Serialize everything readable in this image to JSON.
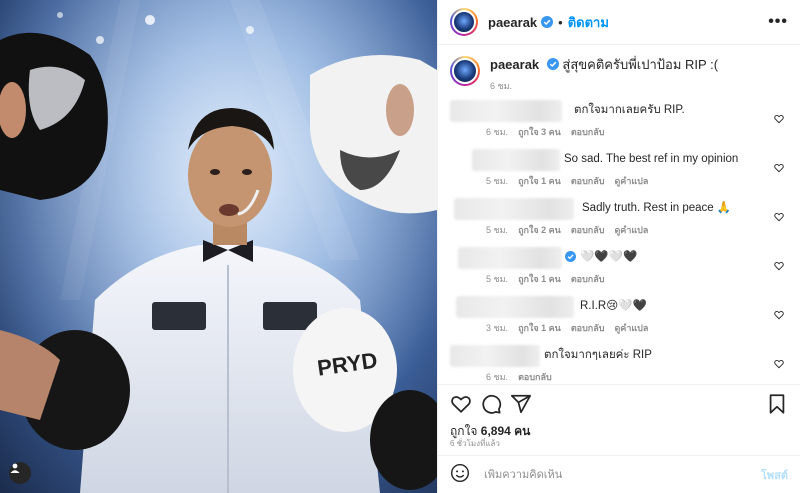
{
  "header": {
    "username": "paearak",
    "follow_label": "ติดตาม",
    "more_label": "•••"
  },
  "caption": {
    "username": "paearak",
    "text": "สู่สุขคติครับพี่เปาป้อม RIP :(",
    "time": "6 ชม."
  },
  "comments": [
    {
      "text": "ตกใจมากเลยครับ RIP.",
      "time": "6 ชม.",
      "likes": "ถูกใจ 3 คน",
      "reply": "ตอบกลับ",
      "translate": ""
    },
    {
      "text": "So sad. The best ref in my opinion",
      "time": "5 ชม.",
      "likes": "ถูกใจ 1 คน",
      "reply": "ตอบกลับ",
      "translate": "ดูคำแปล"
    },
    {
      "text": "Sadly truth. Rest in peace 🙏",
      "time": "5 ชม.",
      "likes": "ถูกใจ 2 คน",
      "reply": "ตอบกลับ",
      "translate": "ดูคำแปล"
    },
    {
      "text": "🤍🖤🤍🖤",
      "time": "5 ชม.",
      "likes": "ถูกใจ 1 คน",
      "reply": "ตอบกลับ",
      "translate": ""
    },
    {
      "text": "R.I.R😢🤍🖤",
      "time": "3 ชม.",
      "likes": "ถูกใจ 1 คน",
      "reply": "ตอบกลับ",
      "translate": "ดูคำแปล"
    },
    {
      "text": "ตกใจมากๆเลยค่ะ RIP",
      "time": "6 ชม.",
      "likes": "",
      "reply": "ตอบกลับ",
      "translate": ""
    }
  ],
  "likes": {
    "label": "ถูกใจ",
    "count": "6,894",
    "unit": "คน"
  },
  "posted_ago": "6 ชั่วโมงที่แล้ว",
  "add_comment": {
    "placeholder": "เพิ่มความคิดเห็น",
    "post_label": "โพสต์"
  },
  "colors": {
    "accent": "#0095f6",
    "verified": "#3897f0",
    "muted": "#8e8e8e"
  }
}
